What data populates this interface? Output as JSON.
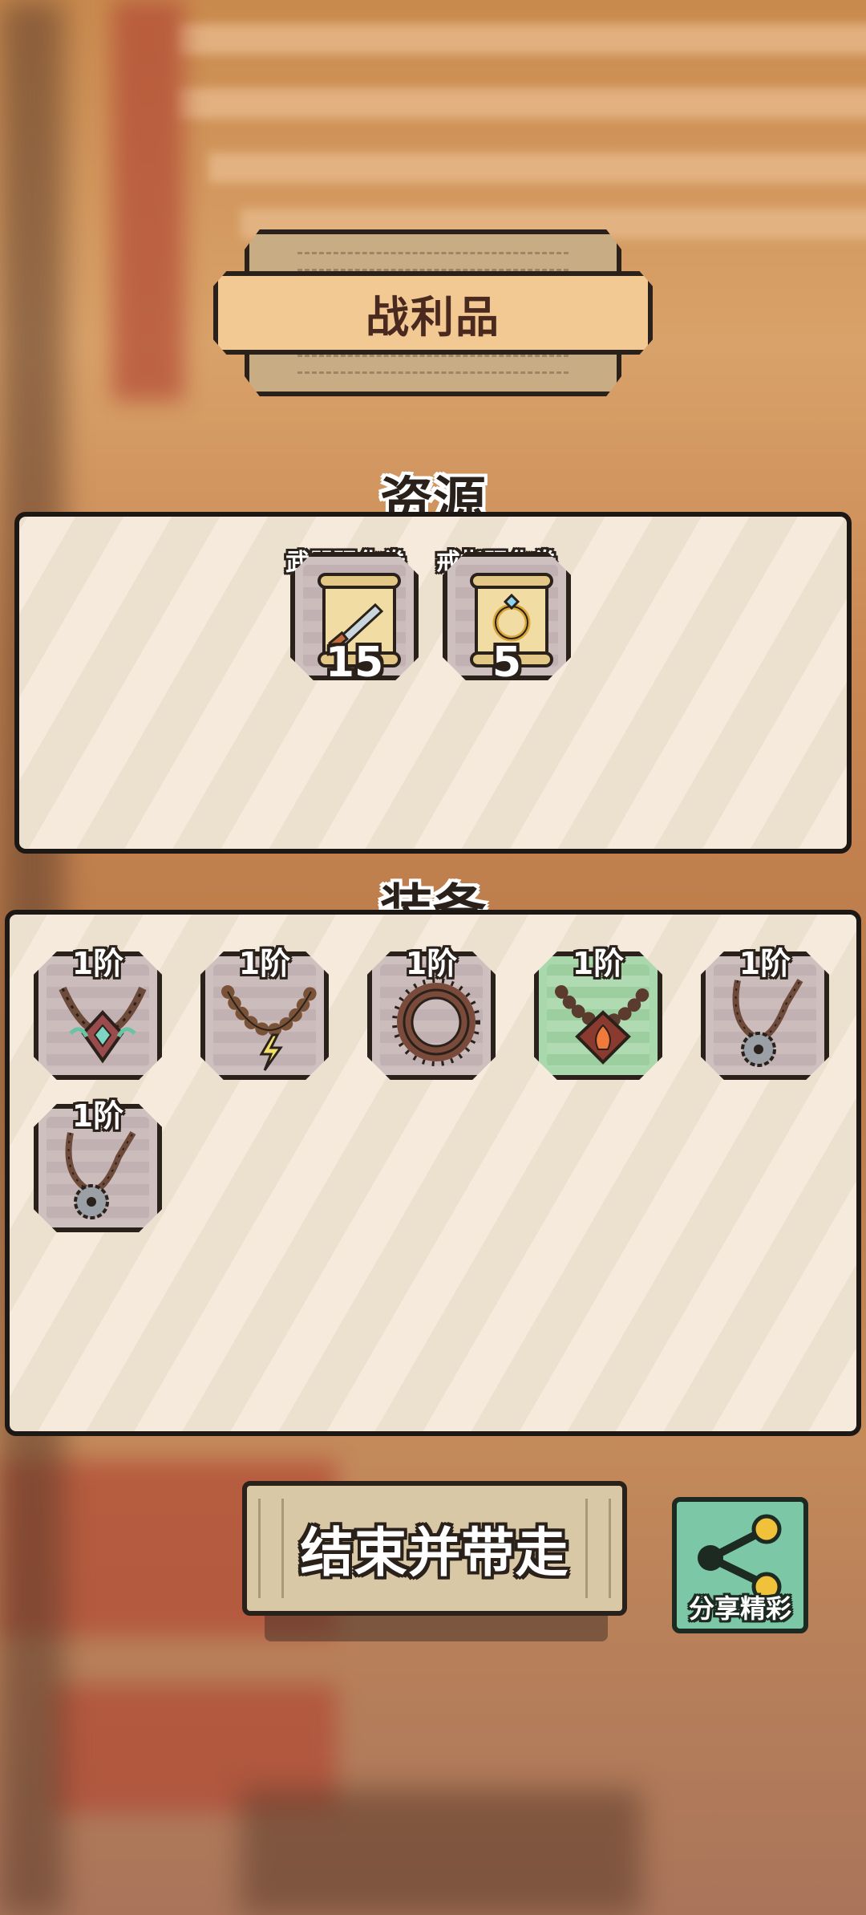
{
  "title": "战利品",
  "resources": {
    "heading": "资源",
    "items": [
      {
        "label": "武器强化卷",
        "count": "15",
        "icon": "weapon-scroll-icon"
      },
      {
        "label": "戒指强化卷",
        "count": "5",
        "icon": "ring-scroll-icon"
      }
    ]
  },
  "equipment": {
    "heading": "装备",
    "items": [
      {
        "tier": "1阶",
        "icon": "gem-necklace-icon",
        "rarity": "common"
      },
      {
        "tier": "1阶",
        "icon": "lightning-bead-necklace-icon",
        "rarity": "common"
      },
      {
        "tier": "1阶",
        "icon": "spiked-ring-icon",
        "rarity": "common"
      },
      {
        "tier": "1阶",
        "icon": "fire-pendant-necklace-icon",
        "rarity": "uncommon"
      },
      {
        "tier": "1阶",
        "icon": "saw-pendant-necklace-icon",
        "rarity": "common"
      },
      {
        "tier": "1阶",
        "icon": "saw-pendant-necklace-icon",
        "rarity": "common"
      }
    ]
  },
  "buttons": {
    "end": "结束并带走",
    "share": "分享精彩"
  },
  "colors": {
    "accent": "#f3c993",
    "uncommon": "#a9d8ad",
    "share": "#7cc7a5"
  }
}
